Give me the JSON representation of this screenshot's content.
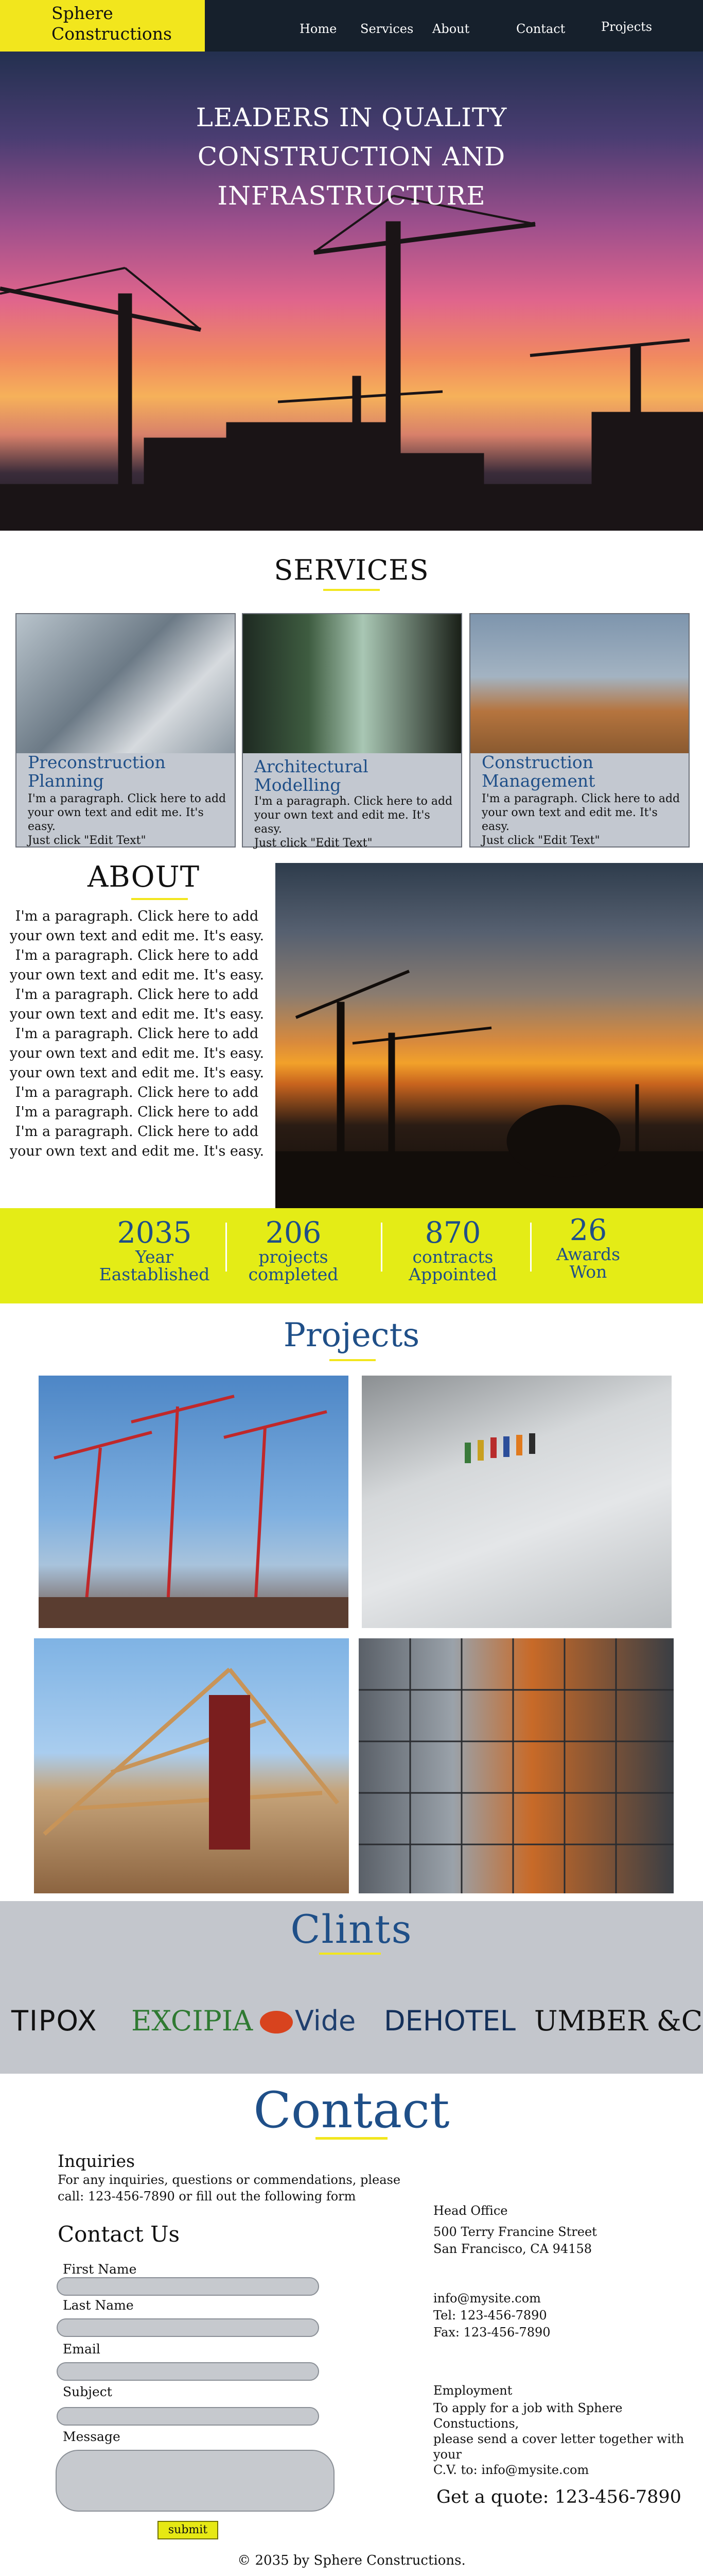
{
  "header": {
    "logo": [
      "Sphere",
      "Constructions"
    ],
    "nav": [
      "Home",
      "Services",
      "About",
      "Contact",
      "Projects"
    ]
  },
  "hero": {
    "title_lines": [
      "LEADERS IN QUALITY",
      "CONSTRUCTION AND",
      "INFRASTRUCTURE"
    ]
  },
  "services": {
    "title": "SERVICES",
    "items": [
      {
        "title": [
          "Preconstruction",
          "Planning"
        ],
        "text": [
          "I'm a paragraph. Click here to add",
          "your own text and edit me. It's easy.",
          "Just click \"Edit Text\""
        ]
      },
      {
        "title": [
          "Architectural",
          "Modelling"
        ],
        "text": [
          "I'm a paragraph. Click here to add",
          "your own text and edit me. It's easy.",
          "Just click \"Edit Text\""
        ]
      },
      {
        "title": [
          "Construction",
          "Management"
        ],
        "text": [
          "I'm a paragraph. Click here to add",
          "your own text and edit me. It's easy.",
          "Just click \"Edit Text\""
        ]
      }
    ]
  },
  "about": {
    "title": "ABOUT",
    "lines": [
      "I'm a paragraph. Click here to add",
      "your own text and edit me. It's easy.",
      "I'm a paragraph. Click here to add",
      "your own text and edit me. It's easy.",
      "I'm a paragraph. Click here to add",
      "your own text and edit me. It's easy.",
      "I'm a paragraph. Click here to add",
      "your own text and edit me. It's easy.",
      "your own text and edit me. It's easy.",
      "I'm a paragraph. Click here to add",
      "I'm a paragraph. Click here to add",
      "I'm a paragraph. Click here to add",
      "your own text and edit me. It's easy."
    ]
  },
  "stats": [
    {
      "number": "2035",
      "label": [
        "Year",
        "Eastablished"
      ]
    },
    {
      "number": "206",
      "label": [
        "projects",
        "completed"
      ]
    },
    {
      "number": "870",
      "label": [
        "contracts",
        "Appointed"
      ]
    },
    {
      "number": "26",
      "label": [
        "Awards",
        "Won"
      ]
    }
  ],
  "projects": {
    "title": "Projects"
  },
  "clients": {
    "title": "Clints",
    "names": [
      "TIPOX",
      "EXCIPIA",
      "Vide",
      "DEHOTEL",
      "UMBER &CO."
    ],
    "colors": {
      "excipia": "#2f7a32",
      "vide_blob": "#d8431e",
      "default": "#111111"
    }
  },
  "contact": {
    "title": "Contact",
    "inquiries_heading": "Inquiries",
    "inquiries_text": [
      "For any inquiries, questions or commendations, please",
      "call: 123-456-7890 or fill out the following form"
    ],
    "form_heading": "Contact Us",
    "labels": [
      "First Name",
      "Last Name",
      "Email",
      "Subject",
      "Message"
    ],
    "submit_label": "submit",
    "head_office": {
      "heading": "Head Office",
      "lines": [
        "500 Terry Francine Street",
        "San Francisco, CA 94158"
      ]
    },
    "contacts": [
      "info@mysite.com",
      "Tel: 123-456-7890",
      "Fax: 123-456-7890"
    ],
    "employment": {
      "heading": "Employment",
      "lines": [
        "To apply for a job with Sphere Constuctions,",
        "please send a cover letter together with your",
        "C.V. to: info@mysite.com"
      ]
    },
    "quote": "Get a quote: 123-456-7890"
  },
  "footer": {
    "copyright": "© 2035 by Sphere Constructions."
  },
  "colors": {
    "accent_yellow": "#f2e61d",
    "stats_bg": "#e4ec16",
    "brand_blue": "#1f4f88",
    "header_bg": "#16202c",
    "clients_bg": "#c3c6cc"
  }
}
